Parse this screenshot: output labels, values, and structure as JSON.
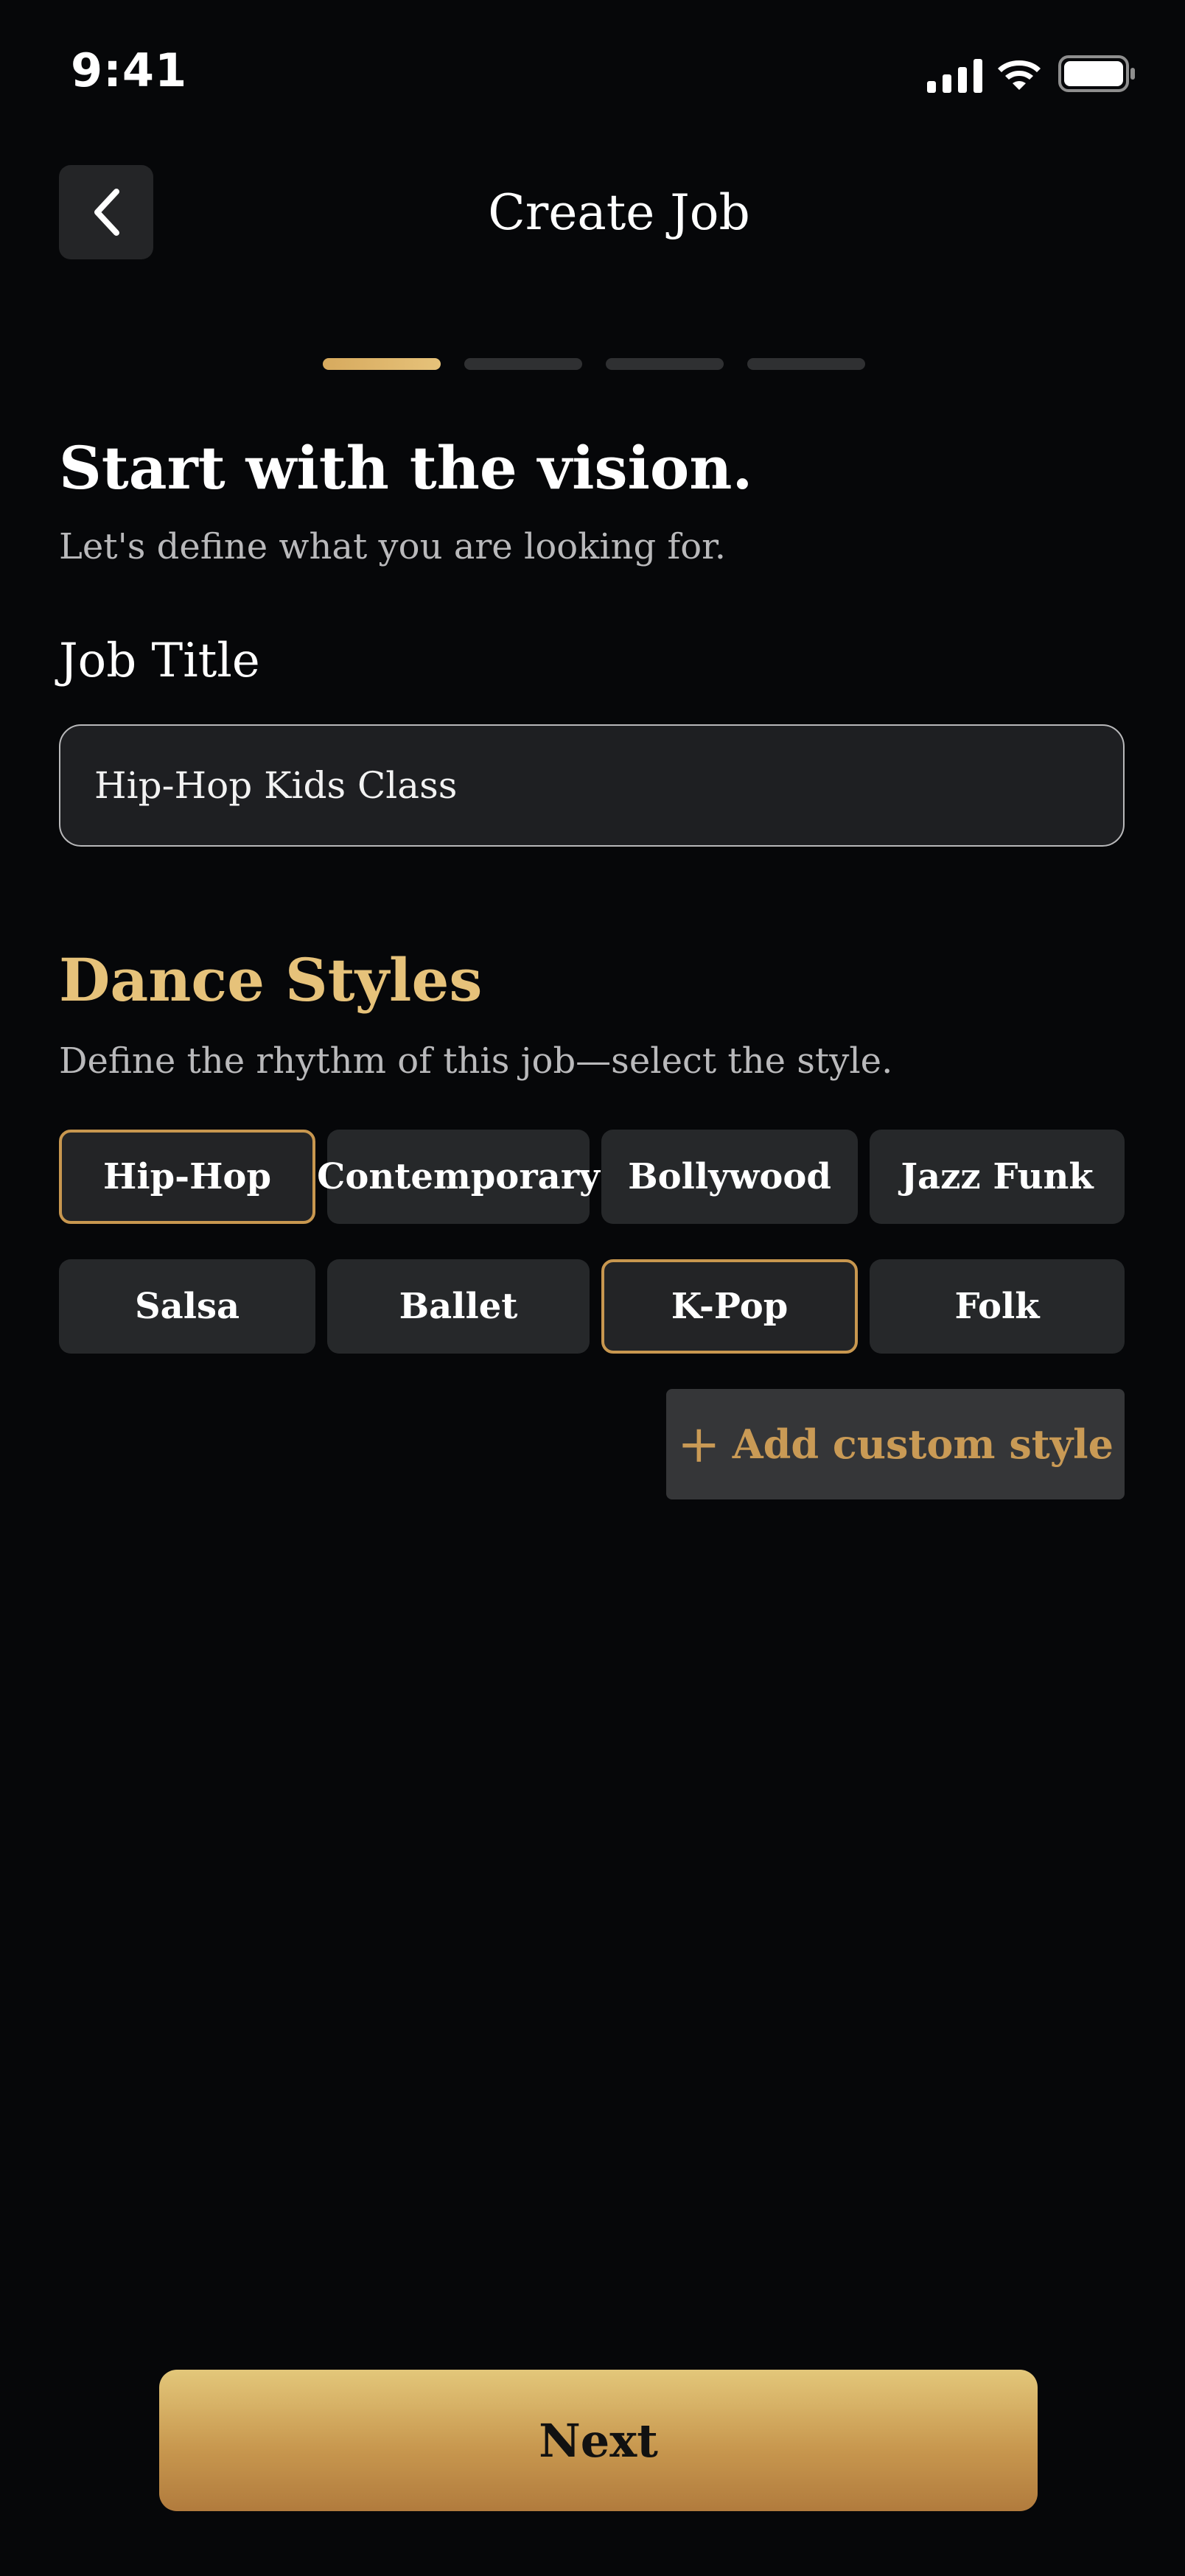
{
  "status_bar": {
    "time": "9:41"
  },
  "header": {
    "title": "Create Job"
  },
  "stepper": {
    "steps": 4,
    "current": 1
  },
  "hero": {
    "heading": "Start with the vision.",
    "subheading": "Let's define what you are looking for."
  },
  "job_title": {
    "label": "Job Title",
    "value": "Hip-Hop Kids Class"
  },
  "dance_styles": {
    "title": "Dance Styles",
    "subtitle": "Define the rhythm of this job—select the style.",
    "options": [
      {
        "label": "Hip-Hop",
        "selected": true
      },
      {
        "label": "Contemporary",
        "selected": false
      },
      {
        "label": "Bollywood",
        "selected": false
      },
      {
        "label": "Jazz Funk",
        "selected": false
      },
      {
        "label": "Salsa",
        "selected": false
      },
      {
        "label": "Ballet",
        "selected": false
      },
      {
        "label": "K-Pop",
        "selected": true
      },
      {
        "label": "Folk",
        "selected": false
      }
    ],
    "add_custom_label": "Add custom style"
  },
  "footer": {
    "next_label": "Next"
  },
  "colors": {
    "background": "#060709",
    "accent_gold": "#e6c27a",
    "chip_bg": "#26282a",
    "selected_border": "#c8974f"
  }
}
